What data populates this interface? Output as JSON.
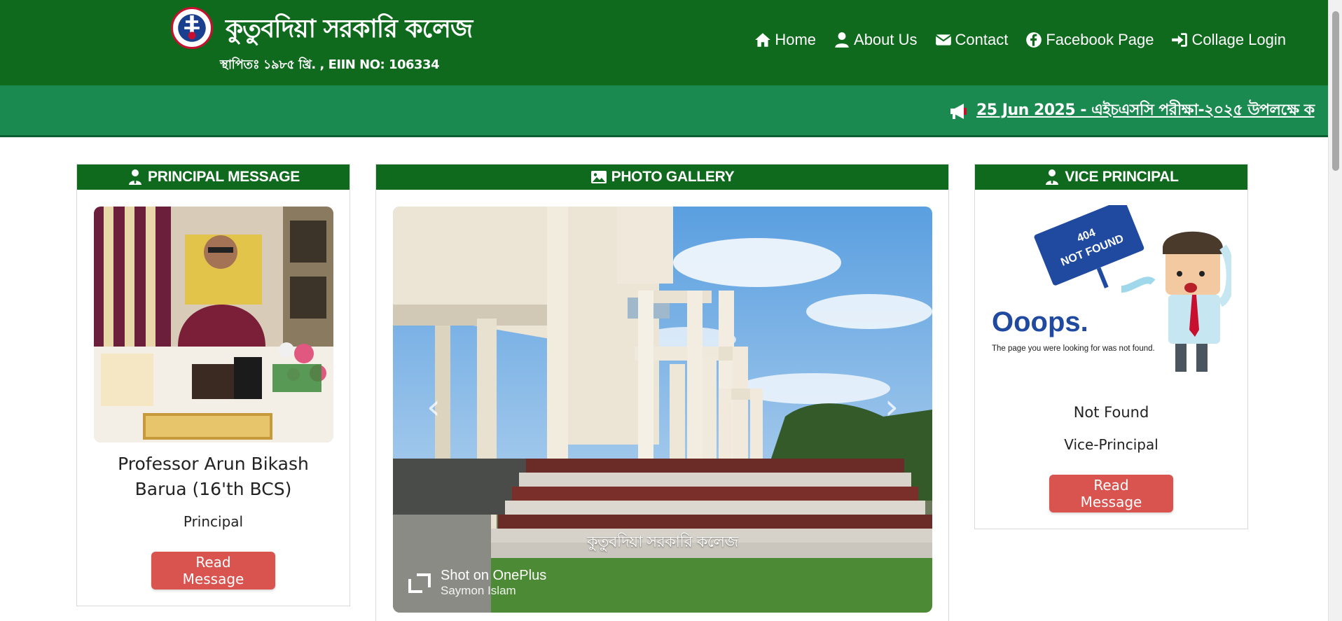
{
  "header": {
    "title": "কুতুবদিয়া সরকারি কলেজ",
    "subtitle": "স্থাপিতঃ ১৯৮৫ খ্রি. , EIIN NO: 106334"
  },
  "nav": [
    {
      "label": "Home",
      "icon": "home-icon"
    },
    {
      "label": "About Us",
      "icon": "user-icon"
    },
    {
      "label": "Contact",
      "icon": "envelope-icon"
    },
    {
      "label": "Facebook Page",
      "icon": "facebook-icon"
    },
    {
      "label": "Collage Login",
      "icon": "sign-in-icon"
    }
  ],
  "notice": {
    "icon": "megaphone-icon",
    "text": "25 Jun 2025 - এইচএসসি পরীক্ষা-২০২৫ উপলক্ষে ক"
  },
  "principal": {
    "header": "PRINCIPAL MESSAGE",
    "name": "Professor Arun Bikash Barua (16'th BCS)",
    "role": "Principal",
    "button": "Read Message"
  },
  "gallery": {
    "header": "PHOTO GALLERY",
    "caption": "কুতুবদিয়া সরকারি কলেজ",
    "watermark_line1": "Shot on OnePlus",
    "watermark_line2": "Saymon Islam",
    "prev": "‹",
    "next": "›"
  },
  "vice": {
    "header": "VICE PRINCIPAL",
    "image_text_sign": "404\nNOT FOUND",
    "image_text_big": "Ooops.",
    "image_text_small": "The page you were looking for was not found.",
    "name": "Not Found",
    "role": "Vice-Principal",
    "button": "Read Message"
  },
  "colors": {
    "header_green": "#0f6a1e",
    "marquee_green": "#1a8a50",
    "button_red": "#d9534f"
  }
}
